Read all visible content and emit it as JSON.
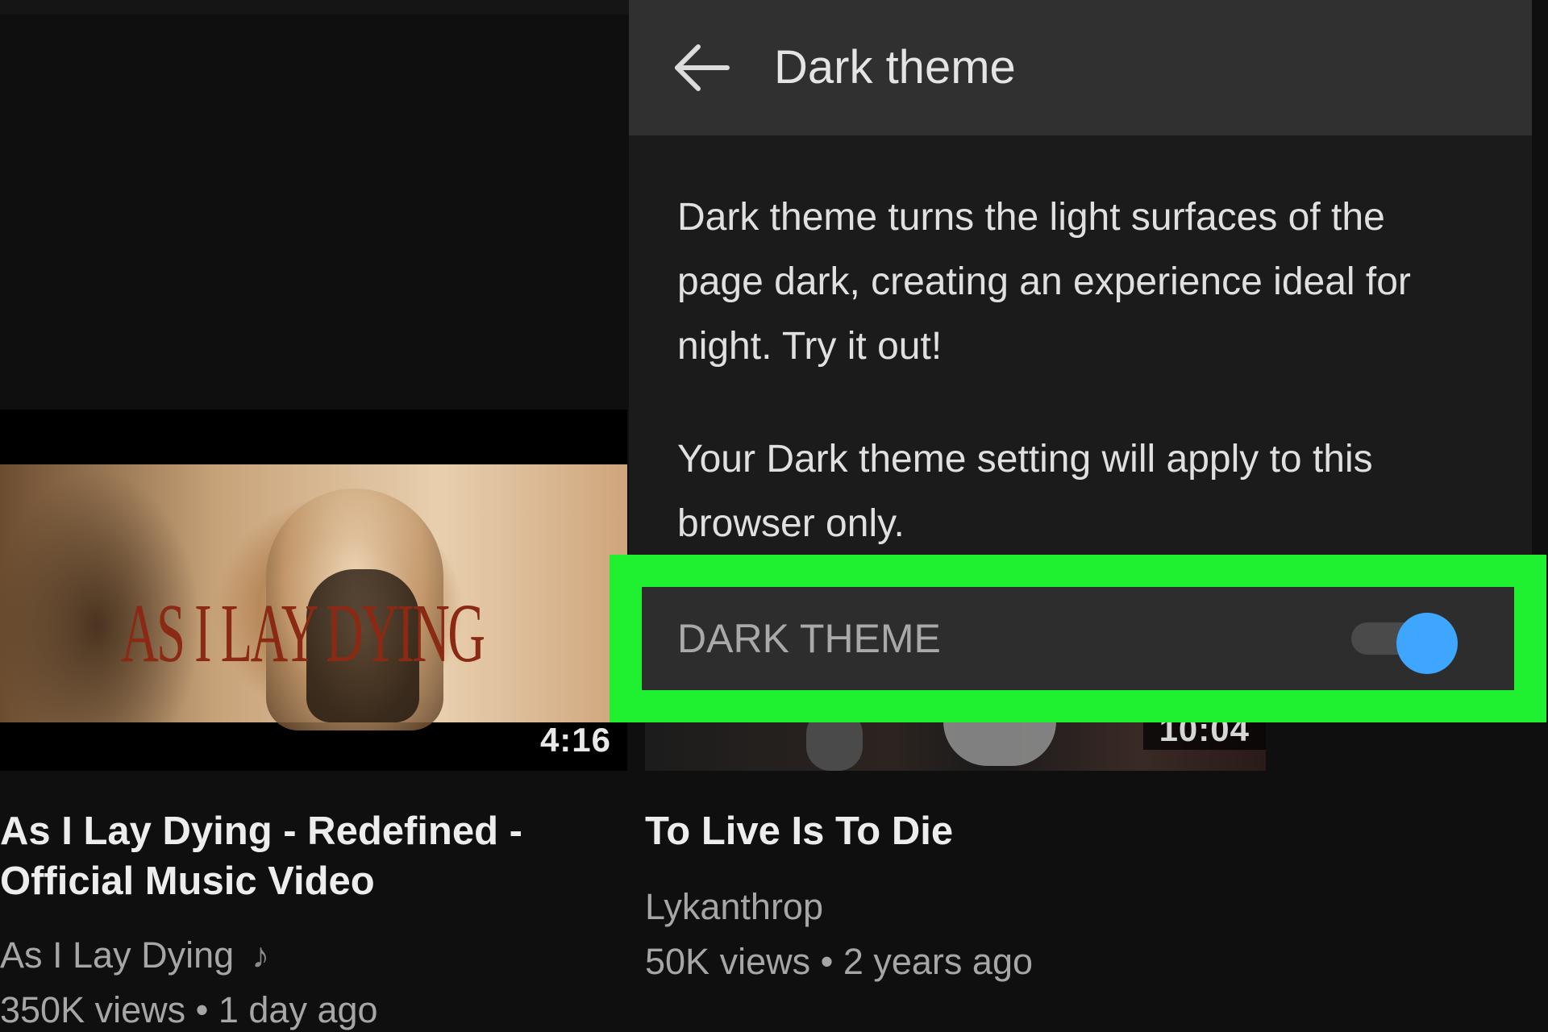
{
  "dialog": {
    "title": "Dark theme",
    "paragraph1_line1": "Dark theme turns the light surfaces of the",
    "paragraph1_line2": "page dark, creating an experience ideal for",
    "paragraph1_line3": "night. Try it out!",
    "paragraph2_line1": "Your Dark theme setting will apply to this",
    "paragraph2_line2": "browser only.",
    "toggle": {
      "label": "DARK THEME",
      "state": "on",
      "accent_color": "#3ea6ff"
    },
    "highlight_color": "#1ff02f"
  },
  "videos": [
    {
      "thumbnail_text": "AS I LAY DYING",
      "duration": "4:16",
      "title_line1": "As I Lay Dying - Redefined -",
      "title_line2": "Official Music Video",
      "channel": "As I Lay Dying",
      "channel_icon": "music-note-icon",
      "meta": "350K views • 1 day ago"
    },
    {
      "duration": "10:04",
      "title_line1": "To Live Is To Die",
      "channel": "Lykanthrop",
      "meta": "50K views • 2 years ago"
    }
  ]
}
